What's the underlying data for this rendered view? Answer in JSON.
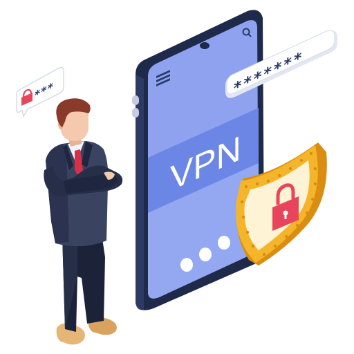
{
  "screen": {
    "label": "VPN"
  },
  "password_field": {
    "masked_text": "*******"
  },
  "lock_bubble": {
    "masked_text": "***"
  },
  "icons": {
    "menu": "hamburger-menu-icon",
    "search": "search-icon",
    "padlock": "padlock-icon",
    "shield": "shield-icon"
  },
  "colors": {
    "phone_body": "#1f2a4a",
    "screen_top": "#8ea2ef",
    "screen_band": "#6c86e6",
    "screen_bottom": "#93a8f1",
    "shield_gold": "#f5b52a",
    "shield_inner": "#fff3d6",
    "lock_red": "#e8455c",
    "suit": "#262f47",
    "tie": "#d9304a",
    "skin": "#f4c9ae",
    "hair": "#8a3a2a"
  }
}
